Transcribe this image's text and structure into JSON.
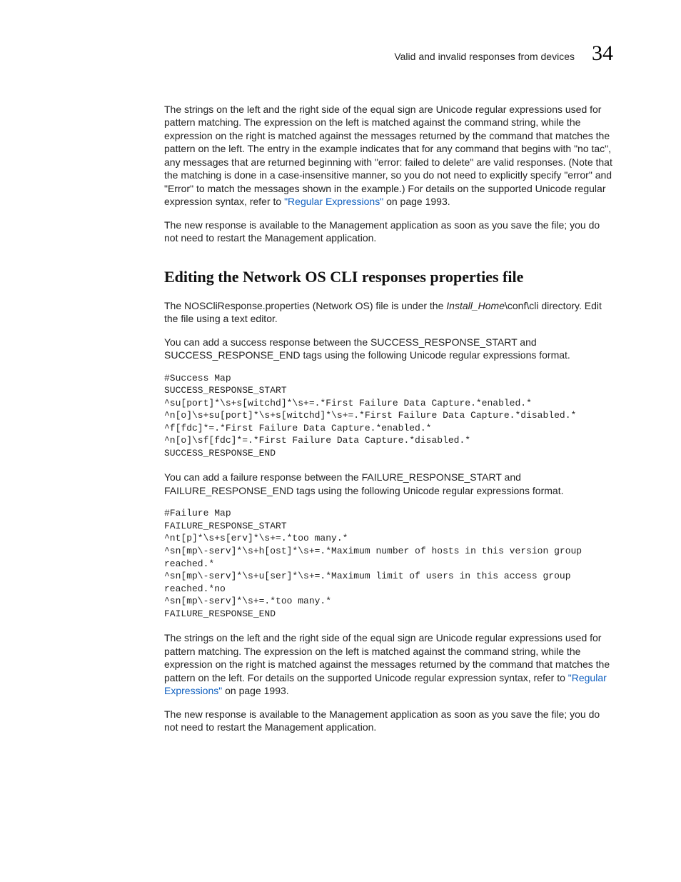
{
  "header": {
    "title": "Valid and invalid responses from devices",
    "chapter": "34"
  },
  "body": {
    "p1a": "The strings on the left and the right side of the equal sign are Unicode regular expressions used for pattern matching. The expression on the left is matched against the command string, while the expression on the right is matched against the messages returned by the command that matches the pattern on the left. The entry in the example indicates that for any command that begins with \"no tac\", any messages that are returned beginning with \"error: failed to delete\" are valid responses. (Note that the matching is done in a case-insensitive manner, so you do not need to explicitly specify \"error\" and \"Error\" to match the messages shown in the example.) For details on the supported Unicode regular expression syntax, refer to ",
    "p1link": "\"Regular Expressions\"",
    "p1b": " on page 1993.",
    "p2": "The new response is available to the Management application as soon as you save the file; you do not need to restart the Management application.",
    "h2": "Editing the Network OS CLI responses properties file",
    "p3a": "The NOSCliResponse.properties (Network OS) file is under the ",
    "p3em": "Install_Home",
    "p3b": "\\conf\\cli directory. Edit the file using a text editor.",
    "p4": "You can add a success response between the SUCCESS_RESPONSE_START and SUCCESS_RESPONSE_END tags using the following Unicode regular expressions format.",
    "code1": "#Success Map\nSUCCESS_RESPONSE_START\n^su[port]*\\s+s[witchd]*\\s+=.*First Failure Data Capture.*enabled.*\n^n[o]\\s+su[port]*\\s+s[witchd]*\\s+=.*First Failure Data Capture.*disabled.*\n^f[fdc]*=.*First Failure Data Capture.*enabled.*\n^n[o]\\sf[fdc]*=.*First Failure Data Capture.*disabled.*\nSUCCESS_RESPONSE_END",
    "p5": "You can add a failure response between the FAILURE_RESPONSE_START and FAILURE_RESPONSE_END tags using the following Unicode regular expressions format.",
    "code2": "#Failure Map\nFAILURE_RESPONSE_START\n^nt[p]*\\s+s[erv]*\\s+=.*too many.*\n^sn[mp\\-serv]*\\s+h[ost]*\\s+=.*Maximum number of hosts in this version group reached.*\n^sn[mp\\-serv]*\\s+u[ser]*\\s+=.*Maximum limit of users in this access group reached.*no\n^sn[mp\\-serv]*\\s+=.*too many.*\nFAILURE_RESPONSE_END",
    "p6a": "The strings on the left and the right side of the equal sign are Unicode regular expressions used for pattern matching. The expression on the left is matched against the command string, while the expression on the right is matched against the messages returned by the command that matches the pattern on the left. For details on the supported Unicode regular expression syntax, refer to ",
    "p6link": "\"Regular Expressions\"",
    "p6b": " on page 1993.",
    "p7": "The new response is available to the Management application as soon as you save the file; you do not need to restart the Management application."
  }
}
